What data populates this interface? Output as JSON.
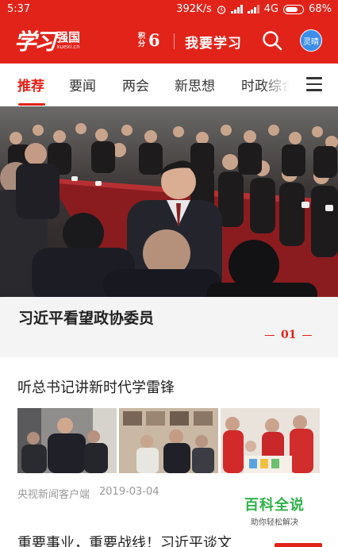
{
  "status_bar": {
    "time": "5:37",
    "speed": "392K/s",
    "network": "4G",
    "battery": "68%"
  },
  "header": {
    "logo_text": "学习",
    "logo_name": "强国",
    "logo_url": "xuexi.cn",
    "points_label": "积分",
    "points_value": "6",
    "study_button": "我要学习",
    "avatar_text": "灵晴"
  },
  "tabs": [
    {
      "label": "推荐",
      "active": true
    },
    {
      "label": "要闻",
      "active": false
    },
    {
      "label": "两会",
      "active": false
    },
    {
      "label": "新思想",
      "active": false
    },
    {
      "label": "时政综合",
      "active": false
    }
  ],
  "hero": {
    "headline": "习近平看望政协委员",
    "page_indicator": "01"
  },
  "article": {
    "title": "听总书记讲新时代学雷锋",
    "source": "央视新闻客户端",
    "date": "2019-03-04"
  },
  "watermark": {
    "title": "百科全说",
    "subtitle": "助你轻松解决"
  },
  "next_article": {
    "title": "重要事业，重要战线！习近平谈文"
  },
  "colors": {
    "brand_red": "#e2231a",
    "avatar_blue": "#3c8fe8",
    "watermark_green": "#2fb24a"
  }
}
